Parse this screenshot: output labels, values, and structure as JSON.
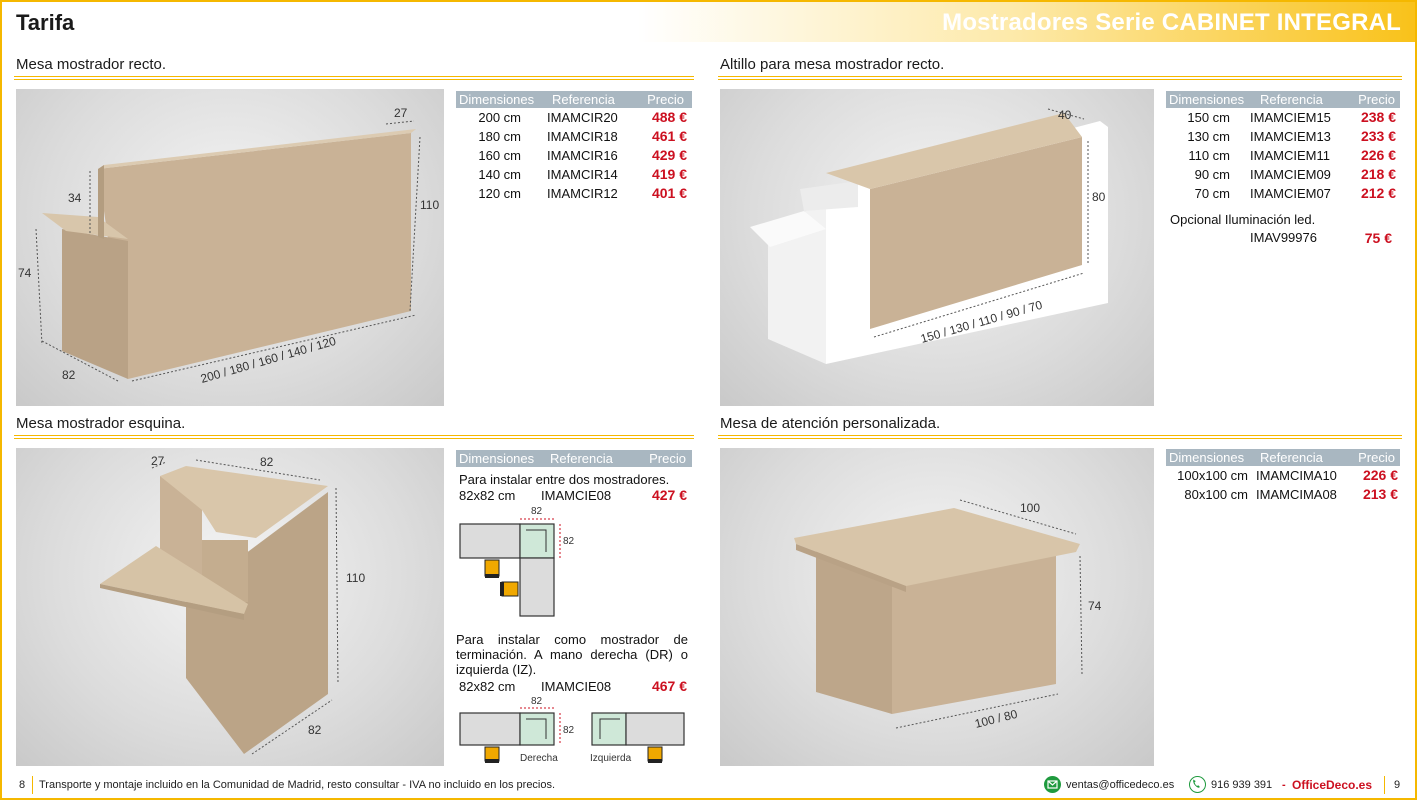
{
  "header": {
    "left_title": "Tarifa",
    "right_title": "Mostradores Serie CABINET INTEGRAL"
  },
  "sections": {
    "recto": {
      "title": "Mesa mostrador recto.",
      "dims": {
        "d27": "27",
        "d34": "34",
        "d110": "110",
        "d74": "74",
        "d82": "82",
        "dwidths": "200 / 180 / 160 / 140 / 120"
      },
      "table": {
        "headers": [
          "Dimensiones",
          "Referencia",
          "Precio"
        ],
        "rows": [
          {
            "dim": "200 cm",
            "ref": "IMAMCIR20",
            "price": "488 €"
          },
          {
            "dim": "180 cm",
            "ref": "IMAMCIR18",
            "price": "461 €"
          },
          {
            "dim": "160 cm",
            "ref": "IMAMCIR16",
            "price": "429 €"
          },
          {
            "dim": "140 cm",
            "ref": "IMAMCIR14",
            "price": "419 €"
          },
          {
            "dim": "120 cm",
            "ref": "IMAMCIR12",
            "price": "401 €"
          }
        ]
      }
    },
    "altillo": {
      "title": "Altillo para mesa mostrador recto.",
      "dims": {
        "d40": "40",
        "d80": "80",
        "dwidths": "150 / 130 / 110 / 90 / 70"
      },
      "table": {
        "headers": [
          "Dimensiones",
          "Referencia",
          "Precio"
        ],
        "rows": [
          {
            "dim": "150 cm",
            "ref": "IMAMCIEM15",
            "price": "238 €"
          },
          {
            "dim": "130 cm",
            "ref": "IMAMCIEM13",
            "price": "233 €"
          },
          {
            "dim": "110 cm",
            "ref": "IMAMCIEM11",
            "price": "226 €"
          },
          {
            "dim": "90 cm",
            "ref": "IMAMCIEM09",
            "price": "218 €"
          },
          {
            "dim": "70 cm",
            "ref": "IMAMCIEM07",
            "price": "212 €"
          }
        ]
      },
      "optional": {
        "label": "Opcional Iluminación led.",
        "ref": "IMAV99976",
        "price": "75 €"
      }
    },
    "esquina": {
      "title": "Mesa mostrador esquina.",
      "dims": {
        "d27": "27",
        "d82top": "82",
        "d110": "110",
        "d82bot": "82"
      },
      "table": {
        "headers": [
          "Dimensiones",
          "Referencia",
          "Precio"
        ]
      },
      "opt1": {
        "text": "Para instalar entre dos mostradores.",
        "dim": "82x82 cm",
        "ref": "IMAMCIE08",
        "price": "427 €"
      },
      "opt2": {
        "text": "Para instalar como mostrador de terminación. A mano derecha (DR) o izquierda (IZ).",
        "dim": "82x82 cm",
        "ref": "IMAMCIE08",
        "price": "467 €"
      },
      "schem": {
        "w": "82",
        "h": "82",
        "derecha": "Derecha",
        "izquierda": "Izquierda"
      }
    },
    "atencion": {
      "title": "Mesa de atención personalizada.",
      "dims": {
        "d100": "100",
        "d74": "74",
        "dwidths": "100 / 80"
      },
      "table": {
        "headers": [
          "Dimensiones",
          "Referencia",
          "Precio"
        ],
        "rows": [
          {
            "dim": "100x100 cm",
            "ref": "IMAMCIMA10",
            "price": "226 €"
          },
          {
            "dim": "80x100 cm",
            "ref": "IMAMCIMA08",
            "price": "213 €"
          }
        ]
      }
    }
  },
  "footer": {
    "page_left": "8",
    "text": "Transporte y montaje incluido en la Comunidad de Madrid, resto consultar - IVA no incluido en los precios.",
    "email": "ventas@officedeco.es",
    "phone": "916 939 391",
    "dash": "-",
    "brand": "OfficeDeco.es",
    "page_right": "9"
  },
  "colors": {
    "accent": "#f5b800",
    "price": "#cc1020",
    "table_header": "#a9b7c1",
    "wood": "#c9b296"
  }
}
